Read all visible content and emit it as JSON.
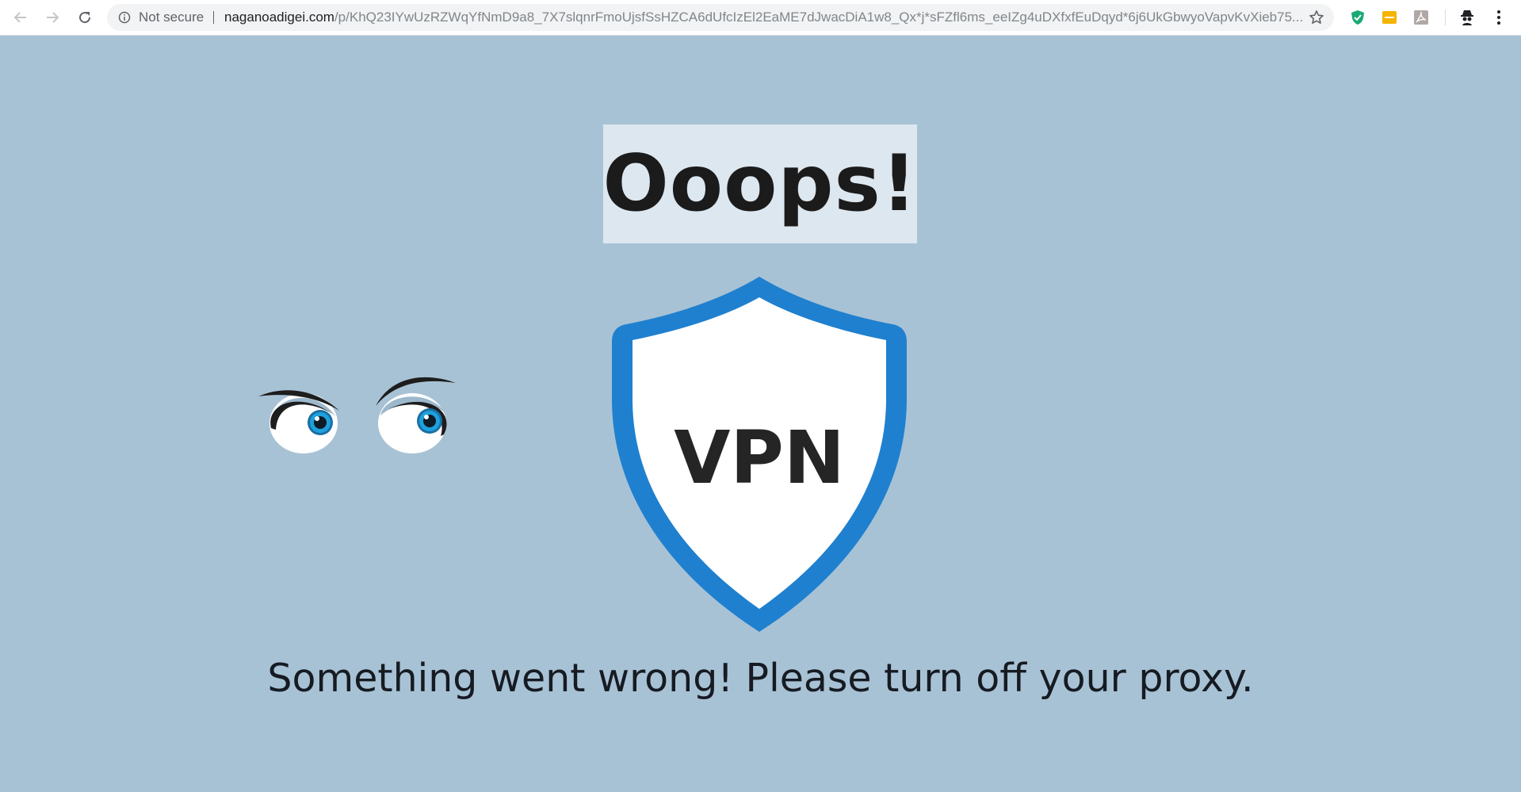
{
  "browser": {
    "security_label": "Not secure",
    "url_domain": "naganoadigei.com",
    "url_path": "/p/KhQ23IYwUzRZWqYfNmD9a8_7X7slqnrFmoUjsfSsHZCA6dUfcIzEl2EaME7dJwacDiA1w8_Qx*j*sFZfl6ms_eeIZg4uDXfxfEuDqyd*6j6UkGbwyoVapvKvXieb75..."
  },
  "page": {
    "title": "Ooops!",
    "shield_label": "VPN",
    "message": "Something went wrong! Please turn off your proxy."
  },
  "colors": {
    "page_background": "#a8c2d5",
    "title_box": "#dde7ef",
    "shield_border": "#1f80cf",
    "iris": "#1ea0dc"
  },
  "icons": {
    "back": "arrow-left-icon",
    "forward": "arrow-right-icon",
    "reload": "reload-icon",
    "info": "info-icon",
    "star": "star-icon",
    "ext1": "green-shield-icon",
    "ext2": "yellow-ext-icon",
    "ext3": "pdf-icon",
    "profile": "incognito-avatar-icon",
    "menu": "kebab-menu-icon"
  }
}
